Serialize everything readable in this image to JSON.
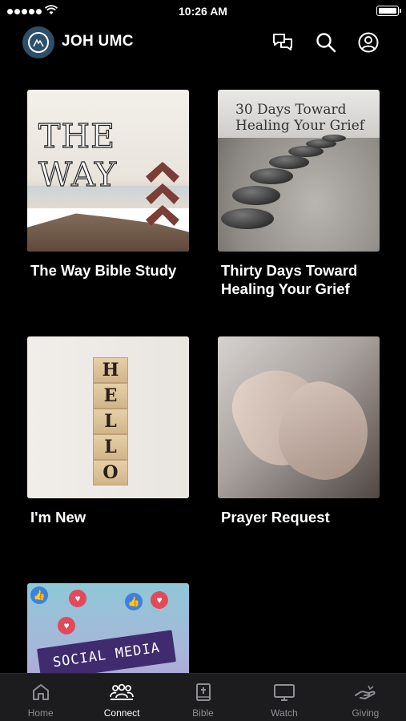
{
  "status_bar": {
    "time": "10:26 AM"
  },
  "header": {
    "app_title": "JOH UMC"
  },
  "cards": [
    {
      "title": "The Way Bible Study",
      "thumb_text": "THE WAY"
    },
    {
      "title": "Thirty Days Toward Healing Your Grief",
      "thumb_text": "30 Days Toward Healing Your Grief"
    },
    {
      "title": "I'm New",
      "thumb_letters": [
        "H",
        "E",
        "L",
        "L",
        "O"
      ]
    },
    {
      "title": "Prayer Request"
    },
    {
      "title": "",
      "thumb_text": "SOCIAL MEDIA"
    }
  ],
  "tabs": [
    {
      "label": "Home",
      "icon": "home-icon",
      "active": false
    },
    {
      "label": "Connect",
      "icon": "connect-icon",
      "active": true
    },
    {
      "label": "Bible",
      "icon": "bible-icon",
      "active": false
    },
    {
      "label": "Watch",
      "icon": "tv-icon",
      "active": false
    },
    {
      "label": "Giving",
      "icon": "giving-icon",
      "active": false
    }
  ],
  "colors": {
    "background": "#000000",
    "tab_bar": "#1c1c1e",
    "tab_active": "#ffffff",
    "tab_inactive": "#8e8e93",
    "logo": "#2e4f6a"
  }
}
